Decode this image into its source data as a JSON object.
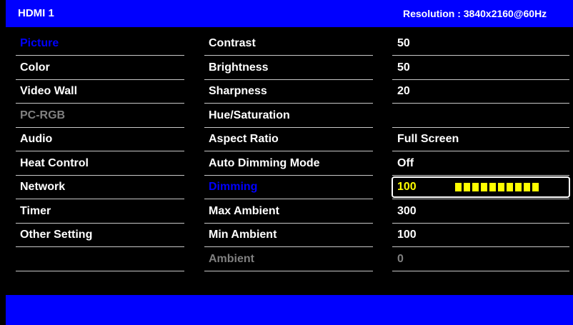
{
  "header": {
    "source": "HDMI 1",
    "resolution": "Resolution : 3840x2160@60Hz"
  },
  "menu": [
    {
      "label": "Picture",
      "state": "selected"
    },
    {
      "label": "Color",
      "state": "normal"
    },
    {
      "label": "Video Wall",
      "state": "normal"
    },
    {
      "label": "PC-RGB",
      "state": "disabled"
    },
    {
      "label": "Audio",
      "state": "normal"
    },
    {
      "label": "Heat Control",
      "state": "normal"
    },
    {
      "label": "Network",
      "state": "normal"
    },
    {
      "label": "Timer",
      "state": "normal"
    },
    {
      "label": "Other Setting",
      "state": "normal"
    }
  ],
  "settings": [
    {
      "label": "Contrast",
      "value": "50",
      "state": "normal"
    },
    {
      "label": "Brightness",
      "value": "50",
      "state": "normal"
    },
    {
      "label": "Sharpness",
      "value": "20",
      "state": "normal"
    },
    {
      "label": "Hue/Saturation",
      "value": "",
      "state": "normal"
    },
    {
      "label": "Aspect Ratio",
      "value": "Full Screen",
      "state": "normal"
    },
    {
      "label": "Auto Dimming Mode",
      "value": "Off",
      "state": "normal"
    },
    {
      "label": "Dimming",
      "value": "100",
      "state": "selected"
    },
    {
      "label": "Max Ambient",
      "value": "300",
      "state": "normal"
    },
    {
      "label": "Min Ambient",
      "value": "100",
      "state": "normal"
    },
    {
      "label": "Ambient",
      "value": "0",
      "state": "disabled"
    }
  ],
  "dimming_bar": {
    "level": 1.0,
    "segments": 10
  },
  "colors": {
    "header_bg": "#0000ff",
    "selected_text": "#0000ff",
    "disabled_text": "#808080",
    "active_value": "#ffff00"
  }
}
